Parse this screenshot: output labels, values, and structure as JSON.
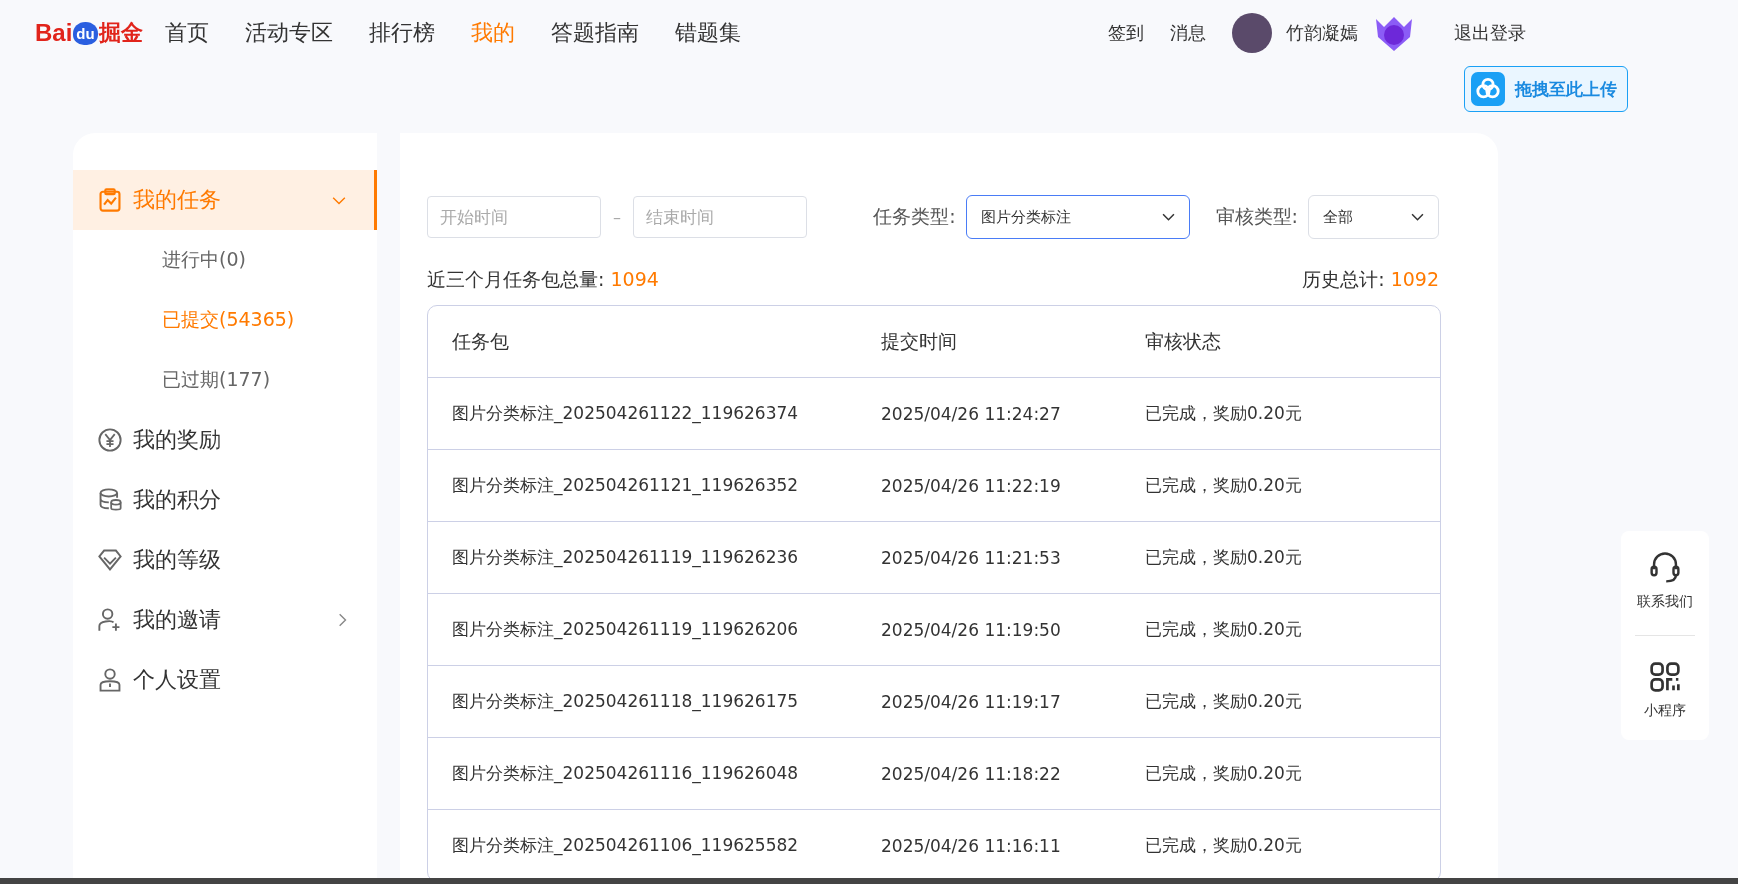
{
  "header": {
    "logo": {
      "brand": "Bai",
      "brand_paw": "du",
      "product": "掘金"
    },
    "nav": [
      {
        "label": "首页",
        "selected": false
      },
      {
        "label": "活动专区",
        "selected": false
      },
      {
        "label": "排行榜",
        "selected": false
      },
      {
        "label": "我的",
        "selected": true
      },
      {
        "label": "答题指南",
        "selected": false
      },
      {
        "label": "错题集",
        "selected": false
      }
    ],
    "checkin": "签到",
    "messages": "消息",
    "username": "竹韵凝嫣",
    "logout": "退出登录"
  },
  "upload_button": "拖拽至此上传",
  "sidebar": {
    "items": [
      {
        "label": "我的任务",
        "kind": "task",
        "expanded": true,
        "selected": true,
        "children": [
          {
            "label": "进行中(0)",
            "selected": false
          },
          {
            "label": "已提交(54365)",
            "selected": true
          },
          {
            "label": "已过期(177)",
            "selected": false
          }
        ]
      },
      {
        "label": "我的奖励",
        "kind": "reward",
        "selected": false
      },
      {
        "label": "我的积分",
        "kind": "points",
        "selected": false
      },
      {
        "label": "我的等级",
        "kind": "level",
        "selected": false
      },
      {
        "label": "我的邀请",
        "kind": "invite",
        "expanded": false,
        "selected": false
      },
      {
        "label": "个人设置",
        "kind": "settings",
        "selected": false
      }
    ]
  },
  "filters": {
    "start": {
      "placeholder": "开始时间"
    },
    "separator": "–",
    "end": {
      "placeholder": "结束时间"
    },
    "task_type": {
      "label": "任务类型:",
      "value": "图片分类标注"
    },
    "review_type": {
      "label": "审核类型:",
      "value": "全部"
    }
  },
  "summary": {
    "recent_label": "近三个月任务包总量: ",
    "recent_value": "1094",
    "total_label": "历史总计: ",
    "total_value": "1092"
  },
  "table": {
    "columns": [
      "任务包",
      "提交时间",
      "审核状态"
    ],
    "rows": [
      [
        "图片分类标注_202504261122_119626374",
        "2025/04/26 11:24:27",
        "已完成，奖励0.20元"
      ],
      [
        "图片分类标注_202504261121_119626352",
        "2025/04/26 11:22:19",
        "已完成，奖励0.20元"
      ],
      [
        "图片分类标注_202504261119_119626236",
        "2025/04/26 11:21:53",
        "已完成，奖励0.20元"
      ],
      [
        "图片分类标注_202504261119_119626206",
        "2025/04/26 11:19:50",
        "已完成，奖励0.20元"
      ],
      [
        "图片分类标注_202504261118_119626175",
        "2025/04/26 11:19:17",
        "已完成，奖励0.20元"
      ],
      [
        "图片分类标注_202504261116_119626048",
        "2025/04/26 11:18:22",
        "已完成，奖励0.20元"
      ],
      [
        "图片分类标注_202504261106_119625582",
        "2025/04/26 11:16:11",
        "已完成，奖励0.20元"
      ]
    ]
  },
  "float_panel": [
    {
      "label": "联系我们",
      "kind": "headset"
    },
    {
      "label": "小程序",
      "kind": "miniapp"
    }
  ]
}
